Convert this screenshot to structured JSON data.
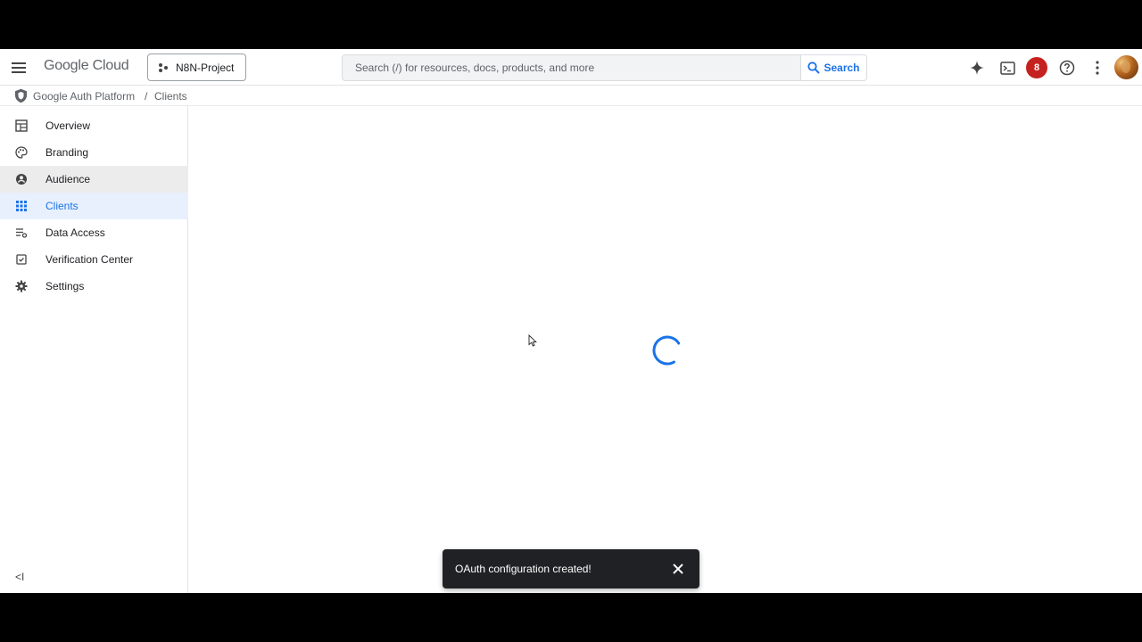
{
  "header": {
    "logo_google": "Google",
    "logo_cloud": "Cloud",
    "project": "N8N-Project",
    "search_placeholder": "Search (/) for resources, docs, products, and more",
    "search_label": "Search",
    "notification_count": "8"
  },
  "breadcrumb": {
    "root": "Google Auth Platform",
    "separator": "/",
    "current": "Clients"
  },
  "sidebar": {
    "items": [
      {
        "label": "Overview",
        "icon": "dashboard-icon"
      },
      {
        "label": "Branding",
        "icon": "palette-icon"
      },
      {
        "label": "Audience",
        "icon": "account-circle-icon"
      },
      {
        "label": "Clients",
        "icon": "apps-grid-icon"
      },
      {
        "label": "Data Access",
        "icon": "data-access-icon"
      },
      {
        "label": "Verification Center",
        "icon": "verification-icon"
      },
      {
        "label": "Settings",
        "icon": "gear-icon"
      }
    ],
    "collapse": "<I"
  },
  "snackbar": {
    "message": "OAuth configuration created!"
  },
  "colors": {
    "accent": "#1a73e8",
    "badge": "#c5221f",
    "snackbar_bg": "#202124"
  }
}
